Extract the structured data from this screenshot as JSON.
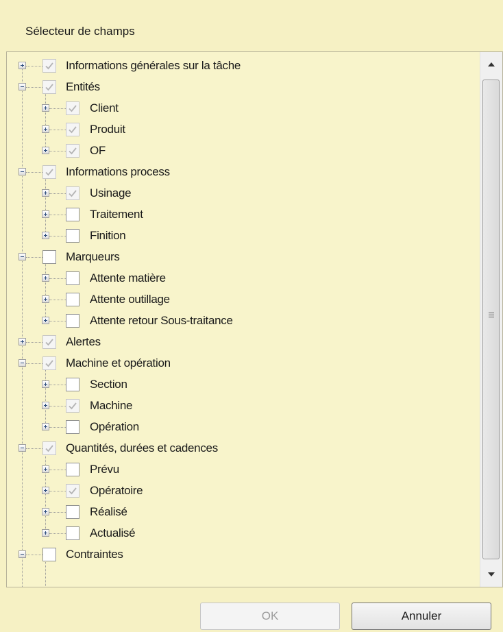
{
  "dialog": {
    "title": "Sélecteur de champs",
    "ok_label": "OK",
    "cancel_label": "Annuler"
  },
  "tree": [
    {
      "label": "Informations générales sur la tâche",
      "level": 0,
      "expanded": false,
      "checked": true,
      "check_disabled": true
    },
    {
      "label": "Entités",
      "level": 0,
      "expanded": true,
      "checked": true,
      "check_disabled": true
    },
    {
      "label": "Client",
      "level": 1,
      "expanded": false,
      "checked": true,
      "check_disabled": true
    },
    {
      "label": "Produit",
      "level": 1,
      "expanded": false,
      "checked": true,
      "check_disabled": true
    },
    {
      "label": "OF",
      "level": 1,
      "expanded": false,
      "checked": true,
      "check_disabled": true
    },
    {
      "label": "Informations process",
      "level": 0,
      "expanded": true,
      "checked": true,
      "check_disabled": true
    },
    {
      "label": "Usinage",
      "level": 1,
      "expanded": false,
      "checked": true,
      "check_disabled": true
    },
    {
      "label": "Traitement",
      "level": 1,
      "expanded": false,
      "checked": false,
      "check_disabled": false
    },
    {
      "label": "Finition",
      "level": 1,
      "expanded": false,
      "checked": false,
      "check_disabled": false
    },
    {
      "label": "Marqueurs",
      "level": 0,
      "expanded": true,
      "checked": false,
      "check_disabled": false
    },
    {
      "label": "Attente matière",
      "level": 1,
      "expanded": false,
      "checked": false,
      "check_disabled": false
    },
    {
      "label": "Attente outillage",
      "level": 1,
      "expanded": false,
      "checked": false,
      "check_disabled": false
    },
    {
      "label": "Attente retour Sous-traitance",
      "level": 1,
      "expanded": false,
      "checked": false,
      "check_disabled": false
    },
    {
      "label": "Alertes",
      "level": 0,
      "expanded": false,
      "checked": true,
      "check_disabled": true
    },
    {
      "label": "Machine et opération",
      "level": 0,
      "expanded": true,
      "checked": true,
      "check_disabled": true
    },
    {
      "label": "Section",
      "level": 1,
      "expanded": false,
      "checked": false,
      "check_disabled": false
    },
    {
      "label": "Machine",
      "level": 1,
      "expanded": false,
      "checked": true,
      "check_disabled": true
    },
    {
      "label": "Opération",
      "level": 1,
      "expanded": false,
      "checked": false,
      "check_disabled": false
    },
    {
      "label": "Quantités, durées et cadences",
      "level": 0,
      "expanded": true,
      "checked": true,
      "check_disabled": true
    },
    {
      "label": "Prévu",
      "level": 1,
      "expanded": false,
      "checked": false,
      "check_disabled": false
    },
    {
      "label": "Opératoire",
      "level": 1,
      "expanded": false,
      "checked": true,
      "check_disabled": true
    },
    {
      "label": "Réalisé",
      "level": 1,
      "expanded": false,
      "checked": false,
      "check_disabled": false
    },
    {
      "label": "Actualisé",
      "level": 1,
      "expanded": false,
      "checked": false,
      "check_disabled": false
    },
    {
      "label": "Contraintes",
      "level": 0,
      "expanded": true,
      "checked": false,
      "check_disabled": false
    }
  ],
  "scrollbar": {
    "up_icon": "arrow-up-icon",
    "down_icon": "arrow-down-icon",
    "grip_icon": "grip-icon"
  },
  "colors": {
    "background": "#f6f1c4",
    "check_disabled": "#b4b4b4"
  }
}
